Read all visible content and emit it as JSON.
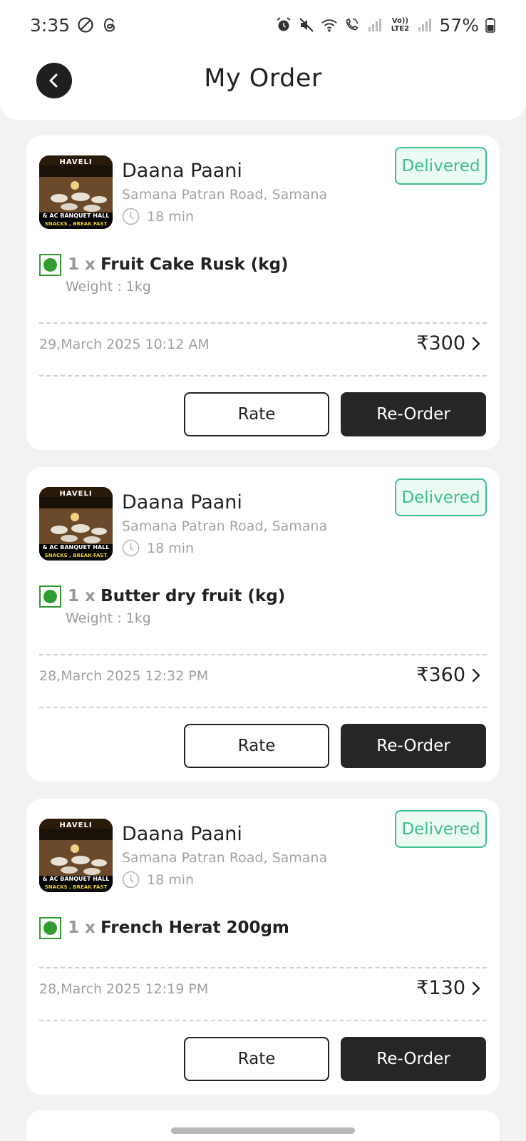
{
  "status_bar": {
    "time": "3:35",
    "battery": "57%",
    "network_label": "Vo)) LTE2",
    "icons": [
      "dnd-icon",
      "threads-icon",
      "alarm-icon",
      "mute-icon",
      "wifi-icon",
      "wifi-calling-icon",
      "signal-icon",
      "signal-icon-2",
      "battery-icon"
    ]
  },
  "header": {
    "title": "My Order",
    "back_icon": "chevron-left-icon"
  },
  "orders": [
    {
      "shop_name": "Daana Paani",
      "address": "Samana Patran Road, Samana",
      "eta": "18 min",
      "status": "Delivered",
      "thumb_text": [
        "HAVELI",
        "& AC BANQUET HALL",
        "SNACKS , BREAK FAST"
      ],
      "qty": "1 x",
      "item": "Fruit Cake Rusk (kg)",
      "weight": "Weight : 1kg",
      "date": "29,March 2025 10:12 AM",
      "price": "₹300",
      "rate_label": "Rate",
      "reorder_label": "Re-Order"
    },
    {
      "shop_name": "Daana Paani",
      "address": "Samana Patran Road, Samana",
      "eta": "18 min",
      "status": "Delivered",
      "thumb_text": [
        "HAVELI",
        "& AC BANQUET HALL",
        "SNACKS , BREAK FAST"
      ],
      "qty": "1 x",
      "item": "Butter dry fruit (kg)",
      "weight": "Weight : 1kg",
      "date": "28,March 2025 12:32 PM",
      "price": "₹360",
      "rate_label": "Rate",
      "reorder_label": "Re-Order"
    },
    {
      "shop_name": "Daana Paani",
      "address": "Samana Patran Road, Samana",
      "eta": "18 min",
      "status": "Delivered",
      "thumb_text": [
        "HAVELI",
        "& AC BANQUET HALL",
        "SNACKS , BREAK FAST"
      ],
      "qty": "1 x",
      "item": "French Herat 200gm",
      "weight": "",
      "date": "28,March 2025 12:19 PM",
      "price": "₹130",
      "rate_label": "Rate",
      "reorder_label": "Re-Order"
    }
  ],
  "colors": {
    "background": "#f2f2f4",
    "delivered": "#3fbf8a",
    "veg": "#2e9d2e",
    "primary_button": "#262626"
  }
}
